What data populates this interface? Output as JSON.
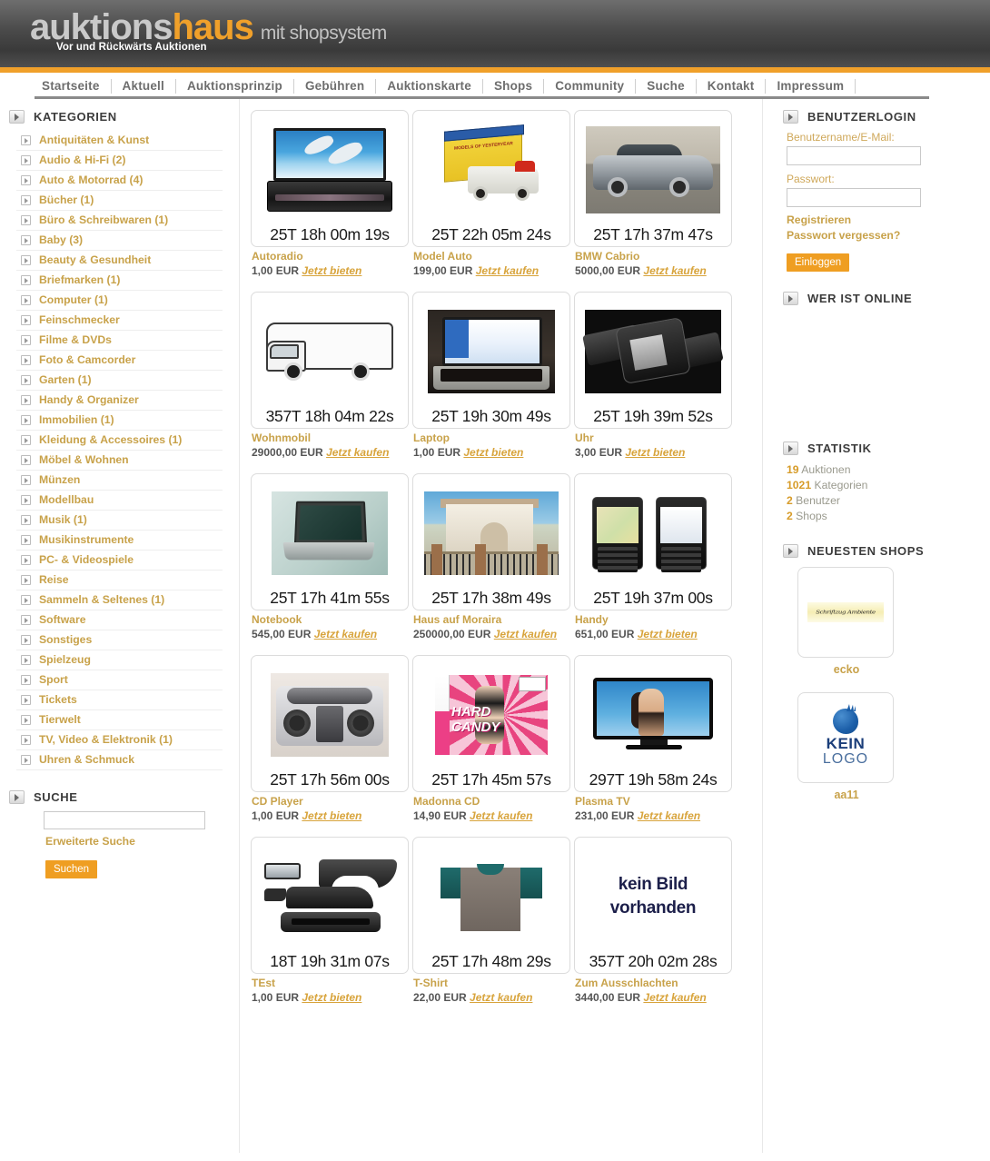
{
  "header": {
    "logo_part1": "auktions",
    "logo_part2": "haus",
    "logo_suffix": "mit shopsystem",
    "tagline": "Vor und Rückwärts Auktionen"
  },
  "nav": {
    "items": [
      {
        "label": "Startseite"
      },
      {
        "label": "Aktuell"
      },
      {
        "label": "Auktionsprinzip"
      },
      {
        "label": "Gebühren"
      },
      {
        "label": "Auktionskarte"
      },
      {
        "label": "Shops"
      },
      {
        "label": "Community"
      },
      {
        "label": "Suche"
      },
      {
        "label": "Kontakt"
      },
      {
        "label": "Impressum"
      }
    ]
  },
  "sidebar": {
    "categories_title": "KATEGORIEN",
    "categories": [
      {
        "label": "Antiquitäten & Kunst"
      },
      {
        "label": "Audio & Hi-Fi (2)"
      },
      {
        "label": "Auto & Motorrad (4)"
      },
      {
        "label": "Bücher (1)"
      },
      {
        "label": "Büro & Schreibwaren (1)"
      },
      {
        "label": "Baby (3)"
      },
      {
        "label": "Beauty & Gesundheit"
      },
      {
        "label": "Briefmarken (1)"
      },
      {
        "label": "Computer (1)"
      },
      {
        "label": "Feinschmecker"
      },
      {
        "label": "Filme & DVDs"
      },
      {
        "label": "Foto & Camcorder"
      },
      {
        "label": "Garten (1)"
      },
      {
        "label": "Handy & Organizer"
      },
      {
        "label": "Immobilien (1)"
      },
      {
        "label": "Kleidung & Accessoires (1)"
      },
      {
        "label": "Möbel & Wohnen"
      },
      {
        "label": "Münzen"
      },
      {
        "label": "Modellbau"
      },
      {
        "label": "Musik (1)"
      },
      {
        "label": "Musikinstrumente"
      },
      {
        "label": "PC- & Videospiele"
      },
      {
        "label": "Reise"
      },
      {
        "label": "Sammeln & Seltenes (1)"
      },
      {
        "label": "Software"
      },
      {
        "label": "Sonstiges"
      },
      {
        "label": "Spielzeug"
      },
      {
        "label": "Sport"
      },
      {
        "label": "Tickets"
      },
      {
        "label": "Tierwelt"
      },
      {
        "label": "TV, Video & Elektronik (1)"
      },
      {
        "label": "Uhren & Schmuck"
      }
    ],
    "search_title": "SUCHE",
    "search_value": "",
    "advanced_search": "Erweiterte Suche",
    "search_button": "Suchen"
  },
  "auctions": [
    {
      "title": "Autoradio",
      "countdown": "25T 18h 00m 19s",
      "price": "1,00 EUR",
      "action": "Jetzt bieten",
      "thumb": "car-radio-image"
    },
    {
      "title": "Model Auto",
      "countdown": "25T 22h 05m 24s",
      "price": "199,00 EUR",
      "action": "Jetzt kaufen",
      "thumb": "model-car-image"
    },
    {
      "title": "BMW Cabrio",
      "countdown": "25T 17h 37m 47s",
      "price": "5000,00 EUR",
      "action": "Jetzt kaufen",
      "thumb": "bmw-convertible-image"
    },
    {
      "title": "Wohnmobil",
      "countdown": "357T 18h 04m 22s",
      "price": "29000,00 EUR",
      "action": "Jetzt kaufen",
      "thumb": "motorhome-image"
    },
    {
      "title": "Laptop",
      "countdown": "25T 19h 30m 49s",
      "price": "1,00 EUR",
      "action": "Jetzt bieten",
      "thumb": "laptop-photo-image"
    },
    {
      "title": "Uhr",
      "countdown": "25T 19h 39m 52s",
      "price": "3,00 EUR",
      "action": "Jetzt bieten",
      "thumb": "watch-image"
    },
    {
      "title": "Notebook",
      "countdown": "25T 17h 41m 55s",
      "price": "545,00 EUR",
      "action": "Jetzt kaufen",
      "thumb": "notebook-image"
    },
    {
      "title": "Haus auf Moraira",
      "countdown": "25T 17h 38m 49s",
      "price": "250000,00 EUR",
      "action": "Jetzt kaufen",
      "thumb": "house-image"
    },
    {
      "title": "Handy",
      "countdown": "25T 19h 37m 00s",
      "price": "651,00 EUR",
      "action": "Jetzt bieten",
      "thumb": "mobile-phone-image"
    },
    {
      "title": "CD Player",
      "countdown": "25T 17h 56m 00s",
      "price": "1,00 EUR",
      "action": "Jetzt bieten",
      "thumb": "cd-player-image"
    },
    {
      "title": "Madonna CD",
      "countdown": "25T 17h 45m 57s",
      "price": "14,90 EUR",
      "action": "Jetzt kaufen",
      "thumb": "madonna-cd-image"
    },
    {
      "title": "Plasma TV",
      "countdown": "297T 19h 58m 24s",
      "price": "231,00 EUR",
      "action": "Jetzt kaufen",
      "thumb": "plasma-tv-image"
    },
    {
      "title": "TEst",
      "countdown": "18T 19h 31m 07s",
      "price": "1,00 EUR",
      "action": "Jetzt bieten",
      "thumb": "car-parts-image"
    },
    {
      "title": "T-Shirt",
      "countdown": "25T 17h 48m 29s",
      "price": "22,00 EUR",
      "action": "Jetzt kaufen",
      "thumb": "tshirt-image"
    },
    {
      "title": "Zum Ausschlachten",
      "countdown": "357T 20h 02m 28s",
      "price": "3440,00 EUR",
      "action": "Jetzt kaufen",
      "thumb": "no-image-placeholder"
    }
  ],
  "no_image_text": {
    "line1": "kein Bild",
    "line2": "vorhanden"
  },
  "right": {
    "login_title": "BENUTZERLOGIN",
    "username_label": "Benutzername/E-Mail:",
    "username_value": "",
    "password_label": "Passwort:",
    "password_value": "",
    "register_link": "Registrieren",
    "forgot_link": "Passwort vergessen?",
    "login_button": "Einloggen",
    "online_title": "WER IST ONLINE",
    "stats_title": "STATISTIK",
    "stats": [
      {
        "num": "19",
        "label": "Auktionen"
      },
      {
        "num": "1021",
        "label": "Kategorien"
      },
      {
        "num": "2",
        "label": "Benutzer"
      },
      {
        "num": "2",
        "label": "Shops"
      }
    ],
    "shops_title": "NEUESTEN SHOPS",
    "shops": [
      {
        "name": "ecko",
        "logo": "handwriting-banner-logo"
      },
      {
        "name": "aa11",
        "logo": "kein-logo-placeholder"
      }
    ],
    "kein_logo": {
      "line1": "KEIN",
      "line2": "LOGO"
    }
  },
  "colors": {
    "accent_orange": "#f0a02a",
    "gold_link": "#c8a24a",
    "header_dark": "#4a4a4a"
  }
}
